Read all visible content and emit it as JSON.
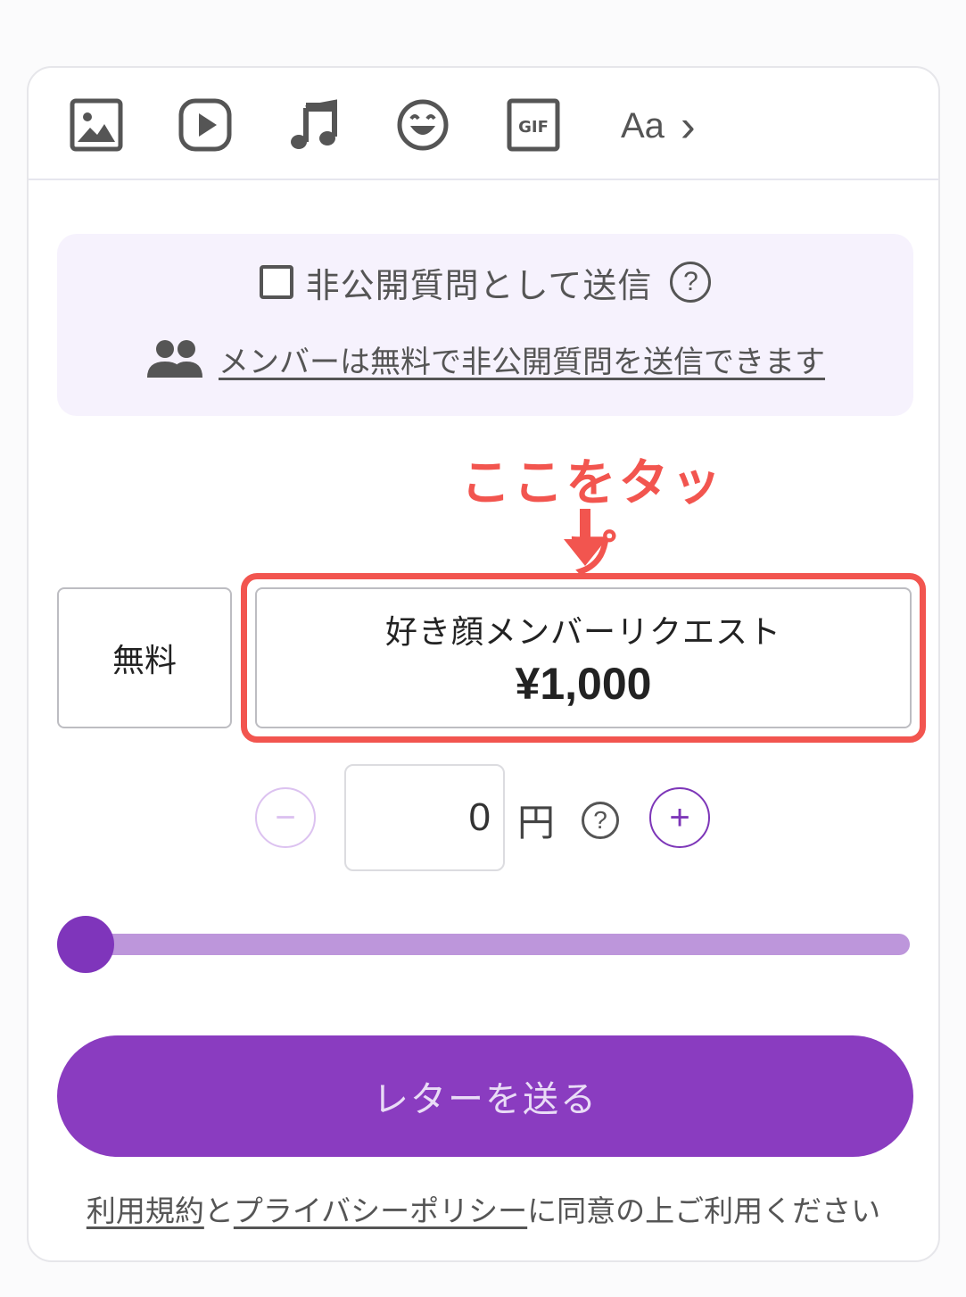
{
  "toolbar": {
    "tools": [
      {
        "icon": "image-icon"
      },
      {
        "icon": "video-play-icon"
      },
      {
        "icon": "music-note-icon"
      },
      {
        "icon": "emoji-icon"
      },
      {
        "icon": "gif-icon",
        "label": "GIF"
      }
    ],
    "font_label": "Aa",
    "font_chevron": "›"
  },
  "private": {
    "checked": false,
    "label": "非公開質問として送信",
    "help": "?",
    "member_link": "メンバーは無料で非公開質問を送信できます"
  },
  "annotation": {
    "text": "ここをタップ",
    "color": "#f2554f"
  },
  "options": {
    "free_label": "無料",
    "request_label": "好き顔メンバーリクエスト",
    "request_price": "¥1,000"
  },
  "amount": {
    "minus": "−",
    "value": "0",
    "unit": "円",
    "help": "?",
    "plus": "+"
  },
  "slider": {
    "value": 0,
    "min": 0,
    "max": 1
  },
  "send_button": {
    "label": "レターを送る",
    "color": "#8a3cc0"
  },
  "terms": {
    "terms_link": "利用規約",
    "joiner": "と",
    "privacy_link": "プライバシーポリシー",
    "suffix": "に同意の上ご利用ください"
  }
}
